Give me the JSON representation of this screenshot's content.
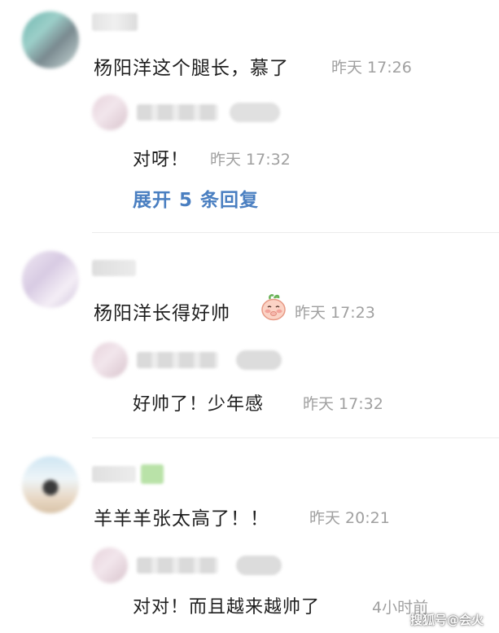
{
  "comments": [
    {
      "text": "杨阳洋这个腿长，慕了",
      "time": "昨天 17:26",
      "reply": {
        "text": "对呀！",
        "time": "昨天 17:32"
      },
      "expand_label": "展开 5 条回复"
    },
    {
      "text": "杨阳洋长得好帅",
      "emoji": "blushing-peach-emoji",
      "time": "昨天 17:23",
      "reply": {
        "text": "好帅了！少年感",
        "time": "昨天 17:32"
      }
    },
    {
      "text": "羊羊羊张太高了！！",
      "time": "昨天 20:21",
      "reply": {
        "text": "对对！而且越来越帅了",
        "time": "4小时前"
      }
    }
  ],
  "watermark": "搜狐号@会火",
  "colors": {
    "link_blue": "#4a7fc1",
    "time_gray": "#a0a0a0",
    "text_dark": "#1f1f1f"
  }
}
